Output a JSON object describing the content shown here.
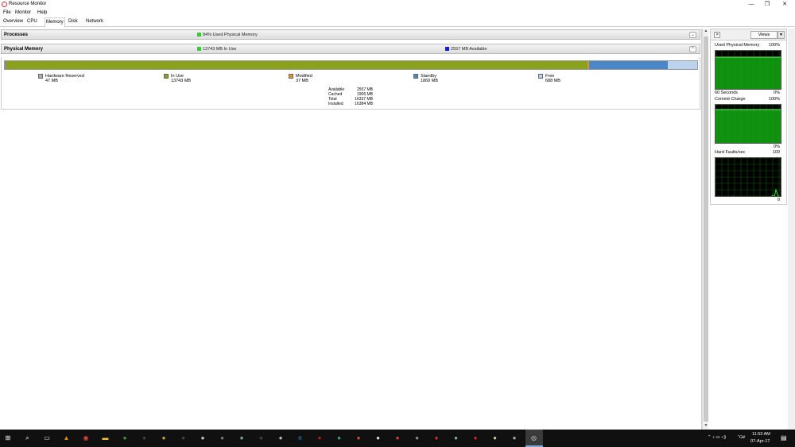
{
  "window": {
    "title": "Resource Monitor",
    "minimize": "—",
    "restore": "❐",
    "close": "✕"
  },
  "menu": [
    "File",
    "Monitor",
    "Help"
  ],
  "tabs": [
    "Overview",
    "CPU",
    "Memory",
    "Disk",
    "Network"
  ],
  "active_tab": "Memory",
  "processes": {
    "title": "Processes",
    "status": "84% Used Physical Memory",
    "status_color": "#33cc33"
  },
  "physical_memory": {
    "title": "Physical Memory",
    "in_use_status": "13743 MB In Use",
    "available_status": "2557 MB Available",
    "in_use_color": "#33cc33",
    "available_color": "#1a1ad0",
    "bar": [
      {
        "name": "Hardware Reserved",
        "mb": 47,
        "color": "#8c8c8c"
      },
      {
        "name": "In Use",
        "mb": 13743,
        "color": "#8aa11b"
      },
      {
        "name": "Modified",
        "mb": 37,
        "color": "#e0932e"
      },
      {
        "name": "Standby",
        "mb": 1869,
        "color": "#4a86c8"
      },
      {
        "name": "Free",
        "mb": 688,
        "color": "#bcd3ee"
      }
    ],
    "legend": [
      {
        "label": "Hardware Reserved",
        "value": "47 MB",
        "color": "#b0b0b0"
      },
      {
        "label": "In Use",
        "value": "13743 MB",
        "color": "#8aa11b"
      },
      {
        "label": "Modified",
        "value": "37 MB",
        "color": "#e0932e"
      },
      {
        "label": "Standby",
        "value": "1869 MB",
        "color": "#4a86c8"
      },
      {
        "label": "Free",
        "value": "688 MB",
        "color": "#bcd3ee"
      }
    ],
    "stats": [
      {
        "label": "Available",
        "value": "2557 MB"
      },
      {
        "label": "Cached",
        "value": "1906 MB"
      },
      {
        "label": "Total",
        "value": "16337 MB"
      },
      {
        "label": "Installed",
        "value": "16384 MB"
      }
    ]
  },
  "side": {
    "views": "Views",
    "expand_icon": ">",
    "graphs": [
      {
        "title": "Used Physical Memory",
        "max": "100%",
        "footer_left": "60 Seconds",
        "footer_right": "0%",
        "fill_fraction": 0.84
      },
      {
        "title": "Commit Charge",
        "max": "100%",
        "footer_left": "",
        "footer_right": "0%",
        "fill_fraction": 0.88
      },
      {
        "title": "Hard Faults/sec",
        "max": "100",
        "footer_left": "",
        "footer_right": "0",
        "fill_fraction": 0.0
      }
    ]
  },
  "taskbar": {
    "icons": [
      "start-icon",
      "search-icon",
      "task-view-icon",
      "vlc-icon",
      "chrome-icon",
      "file-explorer-icon",
      "app-icon",
      "app-icon",
      "app-icon",
      "app-icon",
      "app-icon",
      "app-icon",
      "app-icon",
      "app-icon",
      "app-icon",
      "ie-icon",
      "app-icon",
      "app-icon",
      "app-icon",
      "app-icon",
      "app-icon",
      "app-icon",
      "app-icon",
      "app-icon",
      "app-icon",
      "app-icon",
      "app-icon",
      "resource-monitor-icon"
    ],
    "lang": "עבר",
    "time": "11:53 AM",
    "date": "07-Apr-17"
  }
}
